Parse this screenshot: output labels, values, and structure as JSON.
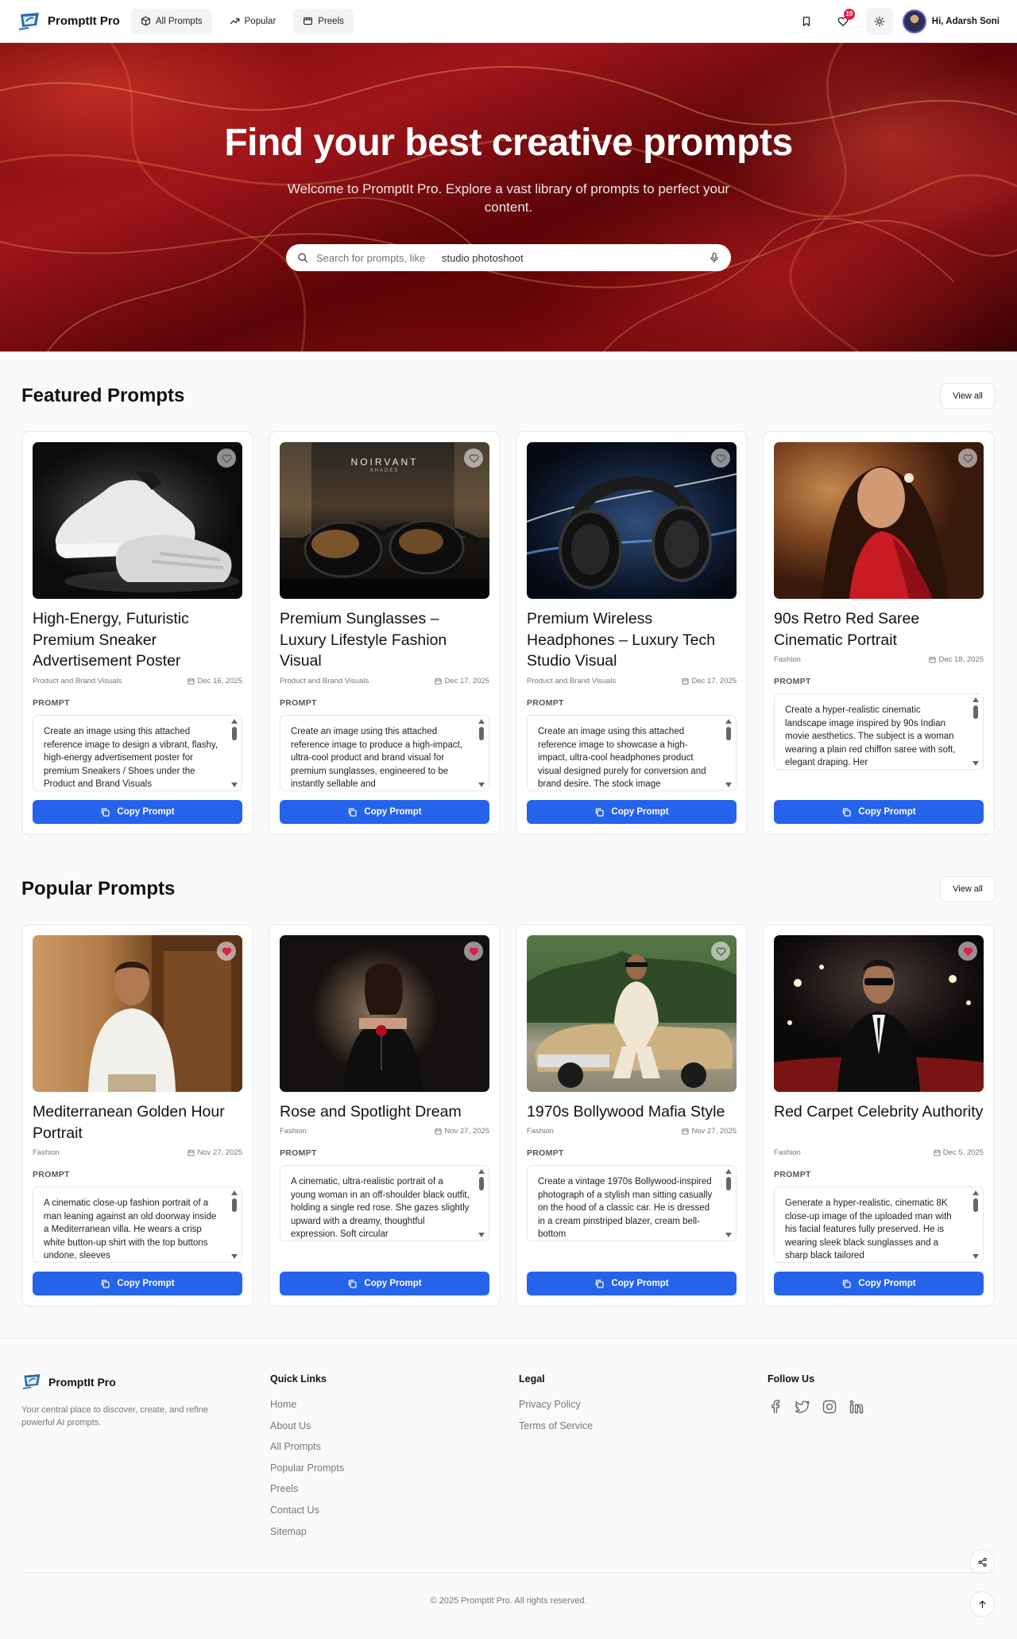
{
  "brand": {
    "name": "PromptIt Pro",
    "accent": "#2563eb"
  },
  "nav": {
    "links": [
      {
        "label": "All Prompts",
        "icon": "box-icon"
      },
      {
        "label": "Popular",
        "icon": "trending-icon"
      },
      {
        "label": "Preels",
        "icon": "film-icon"
      }
    ],
    "notification_count": "10",
    "user_greeting": "Hi, Adarsh Soni"
  },
  "hero": {
    "title": "Find your best creative prompts",
    "subtitle": "Welcome to PromptIt Pro. Explore a vast library of prompts to perfect your content.",
    "search_placeholder": "Search for prompts, like",
    "search_suggestion": "studio photoshoot"
  },
  "featured": {
    "heading": "Featured Prompts",
    "view_all": "View all",
    "prompt_label": "PROMPT",
    "copy_label": "Copy Prompt",
    "cards": [
      {
        "title": "High-Energy, Futuristic Premium Sneaker Advertisement Poster",
        "category": "Product and Brand Visuals",
        "date": "Dec 16, 2025",
        "favorited": false,
        "prompt": "Create an image using this attached reference image to design a vibrant, flashy, high-energy advertisement poster for premium Sneakers / Shoes under the Product and Brand Visuals"
      },
      {
        "title": "Premium Sunglasses – Luxury Lifestyle Fashion Visual",
        "category": "Product and Brand Visuals",
        "date": "Dec 17, 2025",
        "favorited": false,
        "prompt": "Create an image using this attached reference image to produce a high-impact, ultra-cool product and brand visual for premium sunglasses, engineered to be instantly sellable and",
        "image_text": "NOIRVANT",
        "image_subtext": "SHADES"
      },
      {
        "title": "Premium Wireless Headphones – Luxury Tech Studio Visual",
        "category": "Product and Brand Visuals",
        "date": "Dec 17, 2025",
        "favorited": false,
        "prompt": "Create an image using this attached reference image to showcase a high-impact, ultra-cool headphones product visual designed purely for conversion and brand desire. The stock image"
      },
      {
        "title": "90s Retro Red Saree Cinematic Portrait",
        "category": "Fashion",
        "date": "Dec 18, 2025",
        "favorited": false,
        "prompt": "Create a hyper-realistic cinematic landscape image inspired by 90s Indian movie aesthetics. The subject is a woman wearing a plain red chiffon saree with soft, elegant draping. Her"
      }
    ]
  },
  "popular": {
    "heading": "Popular Prompts",
    "view_all": "View all",
    "prompt_label": "PROMPT",
    "copy_label": "Copy Prompt",
    "cards": [
      {
        "title": "Mediterranean Golden Hour Portrait",
        "category": "Fashion",
        "date": "Nov 27, 2025",
        "favorited": true,
        "prompt": "A cinematic close-up fashion portrait of a man leaning against an old doorway inside a Mediterranean villa. He wears a crisp white button-up shirt with the top buttons undone, sleeves"
      },
      {
        "title": "Rose and Spotlight Dream",
        "category": "Fashion",
        "date": "Nov 27, 2025",
        "favorited": true,
        "prompt": "A cinematic, ultra-realistic portrait of a young woman in an off-shoulder black outfit, holding a single red rose. She gazes slightly upward with a dreamy, thoughtful expression. Soft circular"
      },
      {
        "title": "1970s Bollywood Mafia Style",
        "category": "Fashion",
        "date": "Nov 27, 2025",
        "favorited": false,
        "prompt": "Create a vintage 1970s Bollywood-inspired photograph of a stylish man sitting casually on the hood of a classic car. He is dressed in a cream pinstriped blazer, cream bell-bottom"
      },
      {
        "title": "Red Carpet Celebrity Authority",
        "category": "Fashion",
        "date": "Dec 5, 2025",
        "favorited": true,
        "prompt": "Generate a hyper-realistic, cinematic 8K close-up image of the uploaded man with his facial features fully preserved. He is wearing sleek black sunglasses and a sharp black tailored"
      }
    ]
  },
  "footer": {
    "brand": "PromptIt Pro",
    "description": "Your central place to discover, create, and refine powerful AI prompts.",
    "quick_links_heading": "Quick Links",
    "quick_links": [
      "Home",
      "About Us",
      "All Prompts",
      "Popular Prompts",
      "Preels",
      "Contact Us",
      "Sitemap"
    ],
    "legal_heading": "Legal",
    "legal_links": [
      "Privacy Policy",
      "Terms of Service"
    ],
    "follow_heading": "Follow Us",
    "social": [
      "facebook-icon",
      "twitter-icon",
      "instagram-icon",
      "linkedin-icon"
    ],
    "copyright": "© 2025 PromptIt Pro. All rights reserved."
  }
}
